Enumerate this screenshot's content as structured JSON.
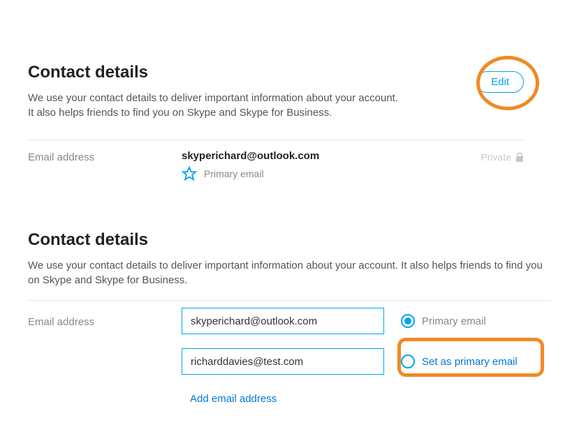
{
  "section1": {
    "title": "Contact details",
    "description": "We use your contact details to deliver important information about your account. It also helps friends to find you on Skype and Skype for Business.",
    "edit_label": "Edit",
    "field_label": "Email address",
    "email": "skyperichard@outlook.com",
    "primary_label": "Primary email",
    "privacy_label": "Private"
  },
  "section2": {
    "title": "Contact details",
    "description": "We use your contact details to deliver important information about your account. It also helps friends to find you on Skype and Skype for Business.",
    "field_label": "Email address",
    "emails": [
      {
        "value": "skyperichard@outlook.com",
        "radio_label": "Primary email",
        "selected": true
      },
      {
        "value": "richarddavies@test.com",
        "radio_label": "Set as primary email",
        "selected": false
      }
    ],
    "add_link": "Add email address"
  }
}
